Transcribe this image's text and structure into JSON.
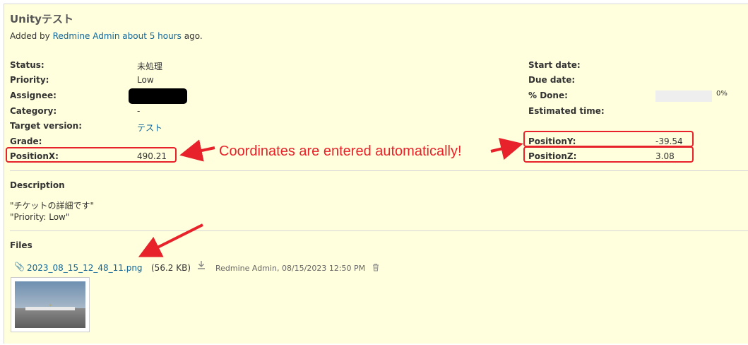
{
  "issue": {
    "title": "Unityテスト",
    "author_prefix": "Added by",
    "author_name": "Redmine Admin",
    "author_time": "about 5 hours",
    "author_suffix": "ago."
  },
  "attributes_left": [
    {
      "label": "Status:",
      "value": "未処理"
    },
    {
      "label": "Priority:",
      "value": "Low"
    },
    {
      "label": "Assignee:",
      "value": ""
    },
    {
      "label": "Category:",
      "value": "-"
    },
    {
      "label": "Target version:",
      "value": "テスト"
    },
    {
      "label": "Grade:",
      "value": ""
    },
    {
      "label": "PositionX:",
      "value": "490.21"
    }
  ],
  "attributes_right": [
    {
      "label": "Start date:",
      "value": ""
    },
    {
      "label": "Due date:",
      "value": ""
    },
    {
      "label": "% Done:",
      "value": "0%"
    },
    {
      "label": "Estimated time:",
      "value": ""
    },
    {
      "label": "PositionY:",
      "value": "-39.54"
    },
    {
      "label": "PositionZ:",
      "value": "3.08"
    }
  ],
  "done_ratio": 0,
  "description": {
    "heading": "Description",
    "lines": [
      "\"チケットの詳細です\"",
      "\"Priority: Low\""
    ]
  },
  "files": {
    "heading": "Files",
    "filename": "2023_08_15_12_48_11.png",
    "size": "(56.2 KB)",
    "meta": "Redmine Admin, 08/15/2023 12:50 PM"
  },
  "annotation": "Coordinates are entered automatically!",
  "icons": [
    "paperclip-icon",
    "download-icon",
    "trash-icon"
  ],
  "colors": {
    "accent": "#e8222a",
    "link": "#116699",
    "background": "#ffffdd"
  }
}
